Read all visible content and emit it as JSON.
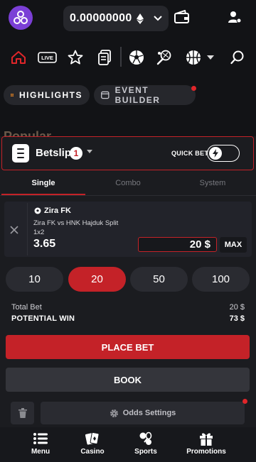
{
  "header": {
    "balance": "0.00000000",
    "currency_icon": "ethereum-icon"
  },
  "nav": {
    "live_label": "LIVE"
  },
  "chips": {
    "highlights": "HIGHLIGHTS",
    "event_builder": "EVENT BUILDER"
  },
  "background_section": "Popular",
  "betslip": {
    "title": "Betslip",
    "count": "1",
    "quick_bet_label": "QUICK BET",
    "tabs": [
      "Single",
      "Combo",
      "System"
    ],
    "active_tab": "Single",
    "selection": {
      "team": "Zira FK",
      "match": "Zira FK vs HNK Hajduk Split",
      "market": "1x2",
      "odds": "3.65",
      "stake": "20 $",
      "max_label": "MAX"
    },
    "quick_stakes": [
      "10",
      "20",
      "50",
      "100"
    ],
    "active_stake": "20",
    "total_bet_label": "Total Bet",
    "total_bet_value": "20 $",
    "potential_win_label": "POTENTIAL WIN",
    "potential_win_value": "73 $",
    "place_bet_label": "PLACE BET",
    "book_label": "BOOK",
    "odds_settings_label": "Odds Settings"
  },
  "bottom_nav": [
    {
      "label": "Menu",
      "icon": "menu-icon"
    },
    {
      "label": "Casino",
      "icon": "cards-icon"
    },
    {
      "label": "Sports",
      "icon": "sports-icon"
    },
    {
      "label": "Promotions",
      "icon": "gift-icon"
    }
  ],
  "colors": {
    "accent": "#c42228",
    "background": "#121316",
    "panel": "#1b1c20",
    "logo": "#7b3fd6"
  }
}
